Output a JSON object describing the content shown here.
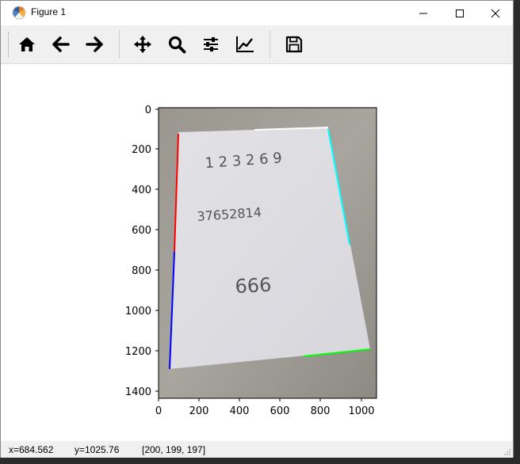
{
  "window": {
    "title": "Figure 1"
  },
  "toolbar": {
    "buttons": [
      {
        "id": "home",
        "icon": "home-icon"
      },
      {
        "id": "back",
        "icon": "arrow-left-icon"
      },
      {
        "id": "forward",
        "icon": "arrow-right-icon"
      },
      {
        "id": "pan",
        "icon": "move-icon"
      },
      {
        "id": "zoom",
        "icon": "magnifier-icon"
      },
      {
        "id": "subplots",
        "icon": "sliders-icon"
      },
      {
        "id": "customize",
        "icon": "line-chart-icon"
      },
      {
        "id": "save",
        "icon": "floppy-disk-icon"
      }
    ]
  },
  "plot": {
    "x_ticks": [
      "0",
      "200",
      "400",
      "600",
      "800",
      "1000"
    ],
    "y_ticks": [
      "0",
      "200",
      "400",
      "600",
      "800",
      "1000",
      "1200",
      "1400"
    ],
    "handwriting": {
      "line1": "1 2 3 2 6 9",
      "line2": "37652814",
      "line3": "666"
    },
    "edge_colors": {
      "left_top": "#ff0000",
      "left_bottom": "#0000ff",
      "right": "#00ffff",
      "top": "#ffffff",
      "bottom": "#00ff00"
    }
  },
  "status": {
    "x": "x=684.562",
    "y": "y=1025.76",
    "rgb": "[200, 199, 197]"
  }
}
